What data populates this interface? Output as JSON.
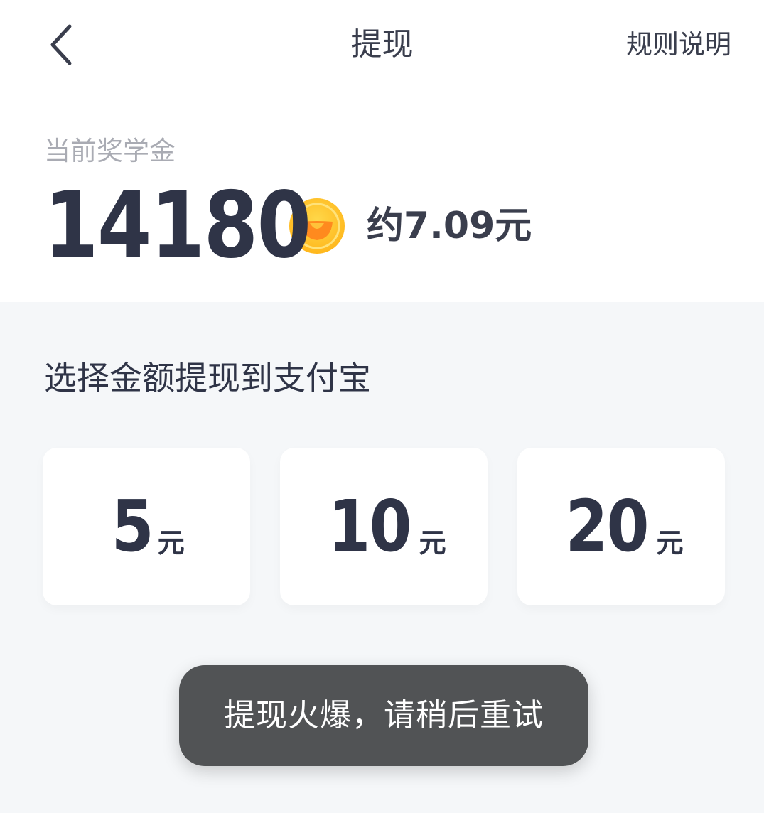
{
  "header": {
    "title": "提现",
    "rules_label": "规则说明"
  },
  "balance": {
    "label": "当前奖学金",
    "amount": "14180",
    "approx": "约7.09元"
  },
  "withdraw": {
    "title": "选择金额提现到支付宝",
    "options": [
      {
        "value": "5",
        "unit": "元"
      },
      {
        "value": "10",
        "unit": "元"
      },
      {
        "value": "20",
        "unit": "元"
      }
    ]
  },
  "toast": {
    "message": "提现火爆，请稍后重试"
  },
  "colors": {
    "primary_text": "#2f3447",
    "secondary_text": "#a9abb3",
    "page_background": "#f5f7f9",
    "coin": "#ffc928",
    "toast_background": "#515355"
  },
  "icons": {
    "back": "chevron-left-icon",
    "coin": "coin-icon"
  }
}
